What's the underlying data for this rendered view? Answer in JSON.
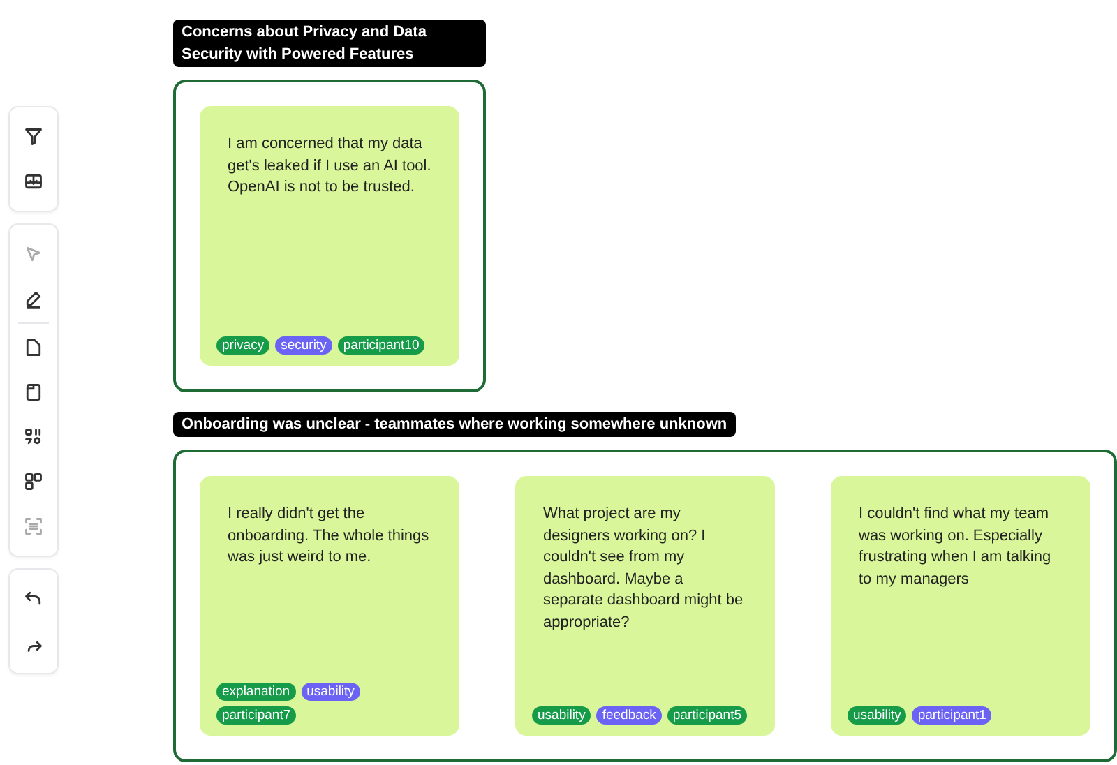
{
  "toolbar": {
    "groups": [
      {
        "sections": [
          [
            {
              "kind": "filter",
              "disabled": false
            },
            {
              "kind": "download",
              "disabled": false
            }
          ]
        ]
      },
      {
        "sections": [
          [
            {
              "kind": "cursor",
              "disabled": true
            },
            {
              "kind": "pen",
              "disabled": false
            }
          ],
          [
            {
              "kind": "file",
              "disabled": false
            },
            {
              "kind": "window",
              "disabled": false
            },
            {
              "kind": "shapes",
              "disabled": false
            },
            {
              "kind": "grid",
              "disabled": false
            },
            {
              "kind": "scan",
              "disabled": true
            }
          ]
        ]
      },
      {
        "sections": [
          [
            {
              "kind": "undo",
              "disabled": false
            },
            {
              "kind": "redo",
              "disabled": false
            }
          ]
        ]
      }
    ]
  },
  "clusters": [
    {
      "title": "Concerns about Privacy and Data Security with Powered Features",
      "notes": [
        {
          "text": "I am concerned that my data get's leaked if I use an AI tool. OpenAI is not to be trusted.",
          "tags": [
            {
              "label": "privacy",
              "color": "#169b48"
            },
            {
              "label": "security",
              "color": "#6b63f3"
            },
            {
              "label": "participant10",
              "color": "#169b48"
            }
          ]
        }
      ]
    },
    {
      "title": "Onboarding was unclear - teammates where working somewhere unknown",
      "notes": [
        {
          "text": "I really didn't get the onboarding. The whole things was just weird to me.",
          "tags": [
            {
              "label": "explanation",
              "color": "#169b48"
            },
            {
              "label": "usability",
              "color": "#6b63f3"
            },
            {
              "label": "participant7",
              "color": "#169b48"
            }
          ]
        },
        {
          "text": "What project are my designers working on? I couldn't see from my dashboard. Maybe a separate dashboard might be appropriate?",
          "tags": [
            {
              "label": "usability",
              "color": "#169b48"
            },
            {
              "label": "feedback",
              "color": "#6b63f3"
            },
            {
              "label": "participant5",
              "color": "#169b48"
            }
          ]
        },
        {
          "text": "I couldn't find what my team was working on. Especially frustrating when I am talking to my managers",
          "tags": [
            {
              "label": "usability",
              "color": "#169b48"
            },
            {
              "label": "participant1",
              "color": "#6b63f3"
            }
          ]
        }
      ]
    }
  ]
}
